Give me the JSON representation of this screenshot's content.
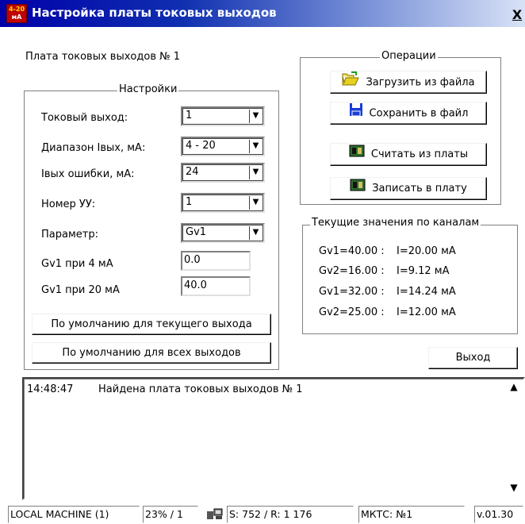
{
  "window": {
    "title": "Настройка платы токовых выходов",
    "app_icon_top": "4-20",
    "app_icon_bottom": "мА",
    "close_label": "X"
  },
  "board_label": "Плата токовых выходов № 1",
  "settings": {
    "legend": "Настройки",
    "rows": [
      {
        "label": "Токовый выход:",
        "value": "1"
      },
      {
        "label": "Диапазон Iвых, мА:",
        "value": "4 - 20"
      },
      {
        "label": "Iвых ошибки, мА:",
        "value": "24"
      },
      {
        "label": "Номер УУ:",
        "value": "1"
      },
      {
        "label": "Параметр:",
        "value": "Gv1"
      }
    ],
    "gv1_4ma_label": "Gv1 при 4 мА",
    "gv1_4ma_value": "0.0",
    "gv1_20ma_label": "Gv1 при 20 мА",
    "gv1_20ma_value": "40.0",
    "default_current_btn": "По умолчанию для текущего выхода",
    "default_all_btn": "По умолчанию для всех выходов"
  },
  "operations": {
    "legend": "Операции",
    "load_btn": "Загрузить из файла",
    "save_btn": "Сохранить в файл",
    "read_btn": "Считать из платы",
    "write_btn": "Записать в плату"
  },
  "current_values": {
    "legend": "Текущие значения по каналам",
    "rows": [
      {
        "param": "Gv1=40.00 :",
        "current": "I=20.00 мА"
      },
      {
        "param": "Gv2=16.00 :",
        "current": "I=9.12 мА"
      },
      {
        "param": "Gv1=32.00 :",
        "current": "I=14.24 мА"
      },
      {
        "param": "Gv2=25.00 :",
        "current": "I=12.00 мА"
      }
    ]
  },
  "exit_btn": "Выход",
  "log": {
    "time": "14:48:47",
    "message": "Найдена плата токовых выходов № 1"
  },
  "status_bar": {
    "machine": "LOCAL MACHINE (1)",
    "load": "23% / 1",
    "stats": "S: 752 / R: 1 176",
    "device": "МКТС: №1",
    "version": "v.01.30"
  },
  "icons": [
    "folder-open-icon",
    "floppy-disk-icon",
    "circuit-board-icon",
    "circuit-board-icon"
  ],
  "colors": {
    "title_start": "#0000a8",
    "title_end": "#d8e2f6",
    "icon_red": "#c00000"
  }
}
